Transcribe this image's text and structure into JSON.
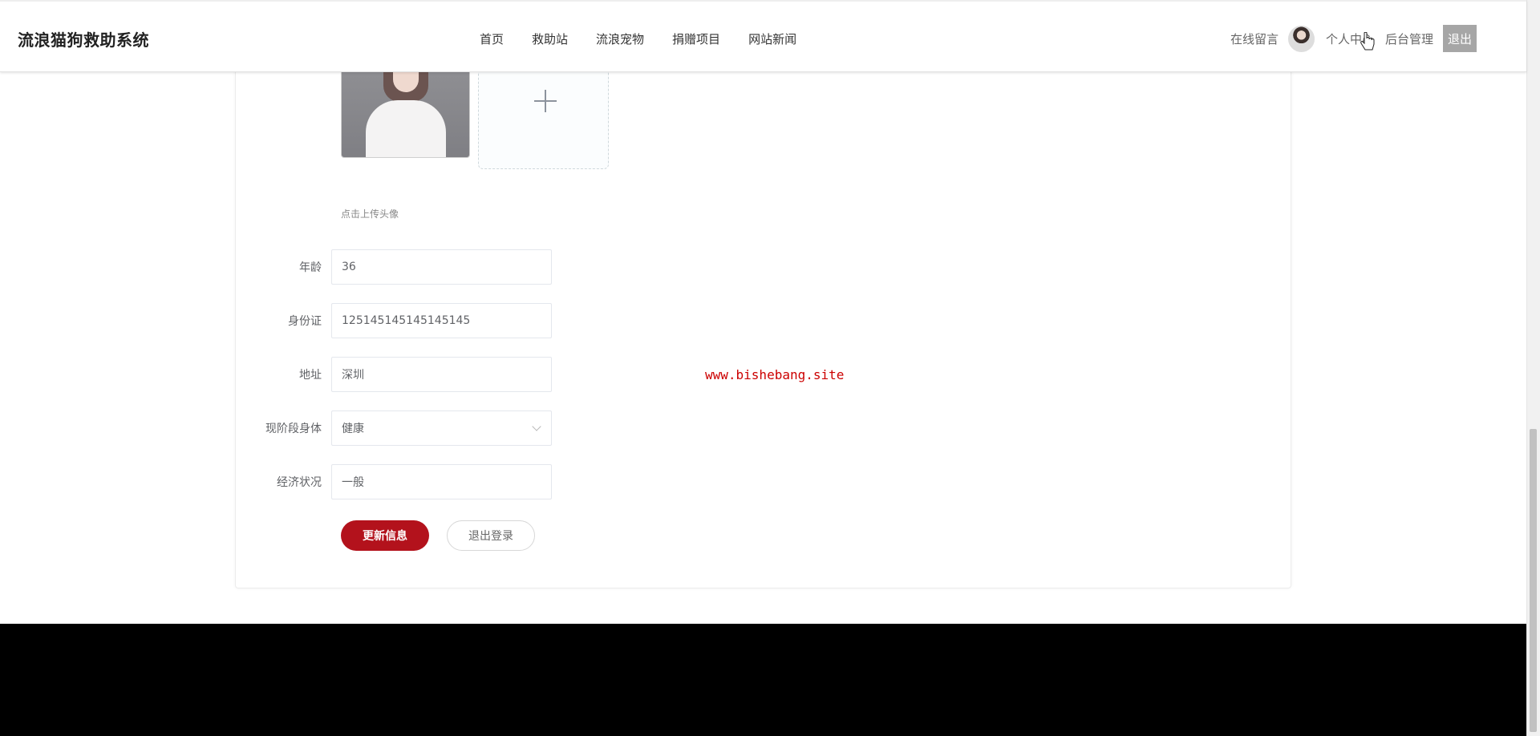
{
  "header": {
    "site_title": "流浪猫狗救助系统",
    "nav": [
      "首页",
      "救助站",
      "流浪宠物",
      "捐赠项目",
      "网站新闻"
    ],
    "right": {
      "message_link": "在线留言",
      "profile_link": "个人中心",
      "admin_link": "后台管理",
      "logout_label": "退出"
    }
  },
  "profile_form": {
    "upload_hint": "点击上传头像",
    "age": {
      "label": "年龄",
      "value": "36"
    },
    "id_card": {
      "label": "身份证",
      "value": "125145145145145145"
    },
    "address": {
      "label": "地址",
      "value": "深圳"
    },
    "health": {
      "label": "现阶段身体",
      "value": "健康"
    },
    "economy": {
      "label": "经济状况",
      "value": "一般"
    },
    "update_button": "更新信息",
    "logout_button": "退出登录"
  },
  "watermark": "www.bishebang.site",
  "colors": {
    "primary": "#b3121c",
    "watermark": "#cc0000",
    "footer": "#000000"
  }
}
